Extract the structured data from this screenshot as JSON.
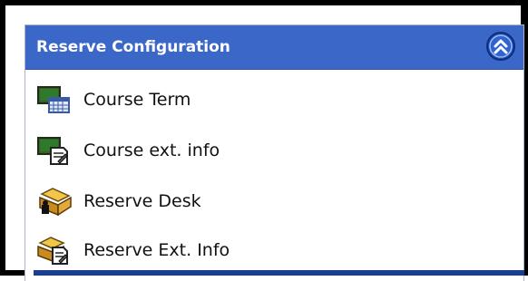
{
  "panel": {
    "title": "Reserve Configuration",
    "collapse_icon": "double-chevron-up-icon",
    "accent_color": "#3a67c8",
    "items": [
      {
        "label": "Course Term",
        "icon": "course-term-calendar-icon"
      },
      {
        "label": "Course ext. info",
        "icon": "course-info-document-icon"
      },
      {
        "label": "Reserve Desk",
        "icon": "reserve-desk-folder-icon"
      },
      {
        "label": "Reserve Ext. Info",
        "icon": "reserve-info-folder-icon"
      }
    ]
  }
}
